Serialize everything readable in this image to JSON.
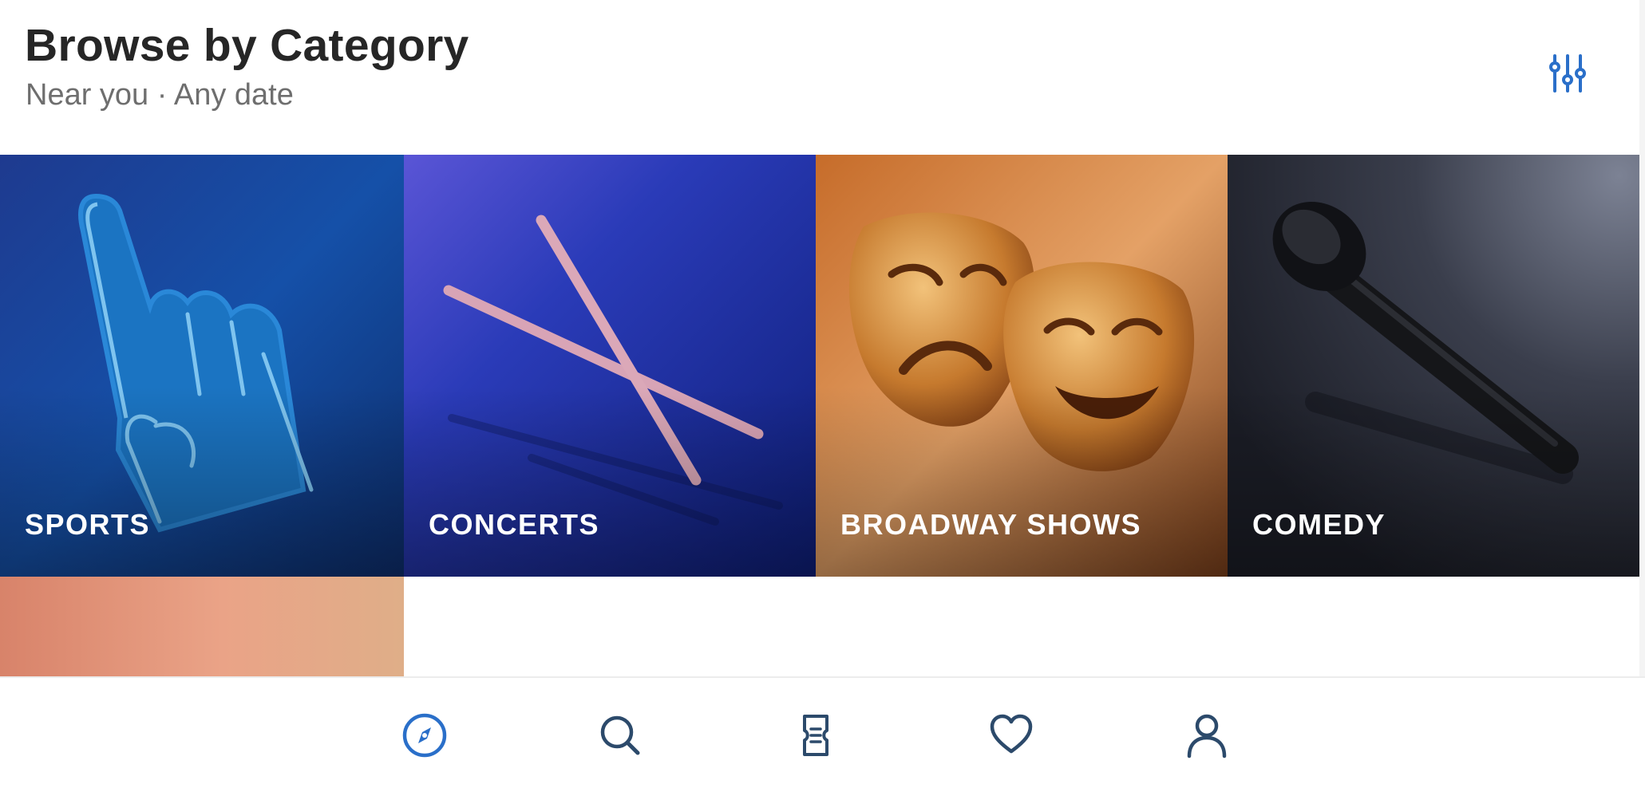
{
  "header": {
    "title": "Browse by Category",
    "subtitle": "Near you · Any date",
    "filter_icon": "sliders-icon"
  },
  "categories": [
    {
      "label": "SPORTS",
      "icon": "foam-finger-image"
    },
    {
      "label": "CONCERTS",
      "icon": "drumsticks-image"
    },
    {
      "label": "BROADWAY SHOWS",
      "icon": "theater-masks-image"
    },
    {
      "label": "COMEDY",
      "icon": "microphone-image"
    }
  ],
  "bottom_nav": [
    {
      "name": "discover",
      "icon": "compass-icon",
      "active": true
    },
    {
      "name": "search",
      "icon": "search-icon",
      "active": false
    },
    {
      "name": "tickets",
      "icon": "ticket-icon",
      "active": false
    },
    {
      "name": "favorites",
      "icon": "heart-icon",
      "active": false
    },
    {
      "name": "account",
      "icon": "user-icon",
      "active": false
    }
  ],
  "colors": {
    "accent": "#2a6fc9",
    "nav_inactive": "#2c4a6b",
    "title": "#262626",
    "subtitle": "#6e6e6e"
  }
}
